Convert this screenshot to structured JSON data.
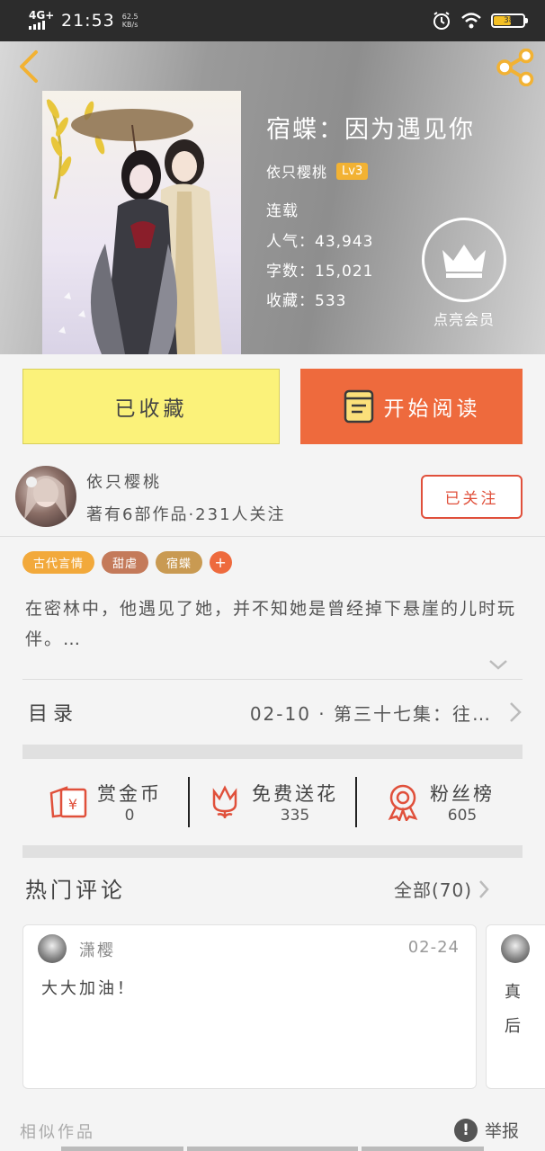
{
  "status_bar": {
    "network": "4G+",
    "time": "21:53",
    "speed_value": "62.5",
    "speed_unit": "KB/s",
    "battery": "38"
  },
  "book": {
    "title": "宿蝶：因为遇见你",
    "author": "依只樱桃",
    "level": "Lv3",
    "status": "连载",
    "popularity_label": "人气：",
    "popularity": "43,943",
    "words_label": "字数：",
    "words": "15,021",
    "favorites_label": "收藏：",
    "favorites": "533",
    "vip_label": "点亮会员"
  },
  "actions": {
    "collected": "已收藏",
    "start_reading": "开始阅读"
  },
  "author_info": {
    "name": "依只樱桃",
    "stats": "著有6部作品·231人关注",
    "follow": "已关注"
  },
  "tags": [
    {
      "label": "古代言情",
      "color": "#f2a93b"
    },
    {
      "label": "甜虐",
      "color": "#c47a5a"
    },
    {
      "label": "宿蝶",
      "color": "#c99a52"
    },
    {
      "label": "+",
      "color": "#ee6a3d"
    }
  ],
  "synopsis": "在密林中，他遇见了她，并不知她是曾经掉下悬崖的儿时玩伴。…",
  "toc": {
    "label": "目录",
    "latest": "02-10 · 第三十七集：往…"
  },
  "stats": [
    {
      "label": "赏金币",
      "value": "0"
    },
    {
      "label": "免费送花",
      "value": "335"
    },
    {
      "label": "粉丝榜",
      "value": "605"
    }
  ],
  "comments": {
    "title": "热门评论",
    "all_label": "全部(70)",
    "items": [
      {
        "user": "潇樱",
        "date": "02-24",
        "text": "大大加油！"
      },
      {
        "user": "",
        "date": "",
        "text": "真 后"
      }
    ]
  },
  "footer": {
    "similar": "相似作品",
    "report": "举报"
  },
  "colors": {
    "accent_orange": "#ee6a3d",
    "collect_yellow": "#fbf27a",
    "follow_red": "#e0503b",
    "lv_badge": "#f2b233",
    "icon_red": "#e0503b"
  }
}
